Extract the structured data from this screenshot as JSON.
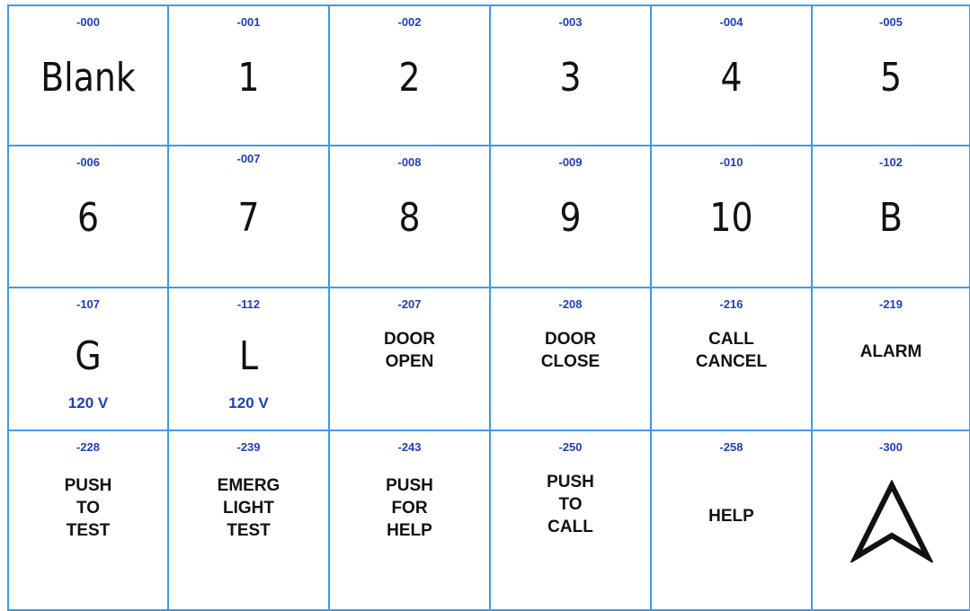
{
  "rows": [
    [
      {
        "code": "-000",
        "label": "Blank"
      },
      {
        "code": "-001",
        "label": "1"
      },
      {
        "code": "-002",
        "label": "2"
      },
      {
        "code": "-003",
        "label": "3"
      },
      {
        "code": "-004",
        "label": "4"
      },
      {
        "code": "-005",
        "label": "5"
      }
    ],
    [
      {
        "code": "-006",
        "label": "6"
      },
      {
        "code": "-007",
        "label": "7"
      },
      {
        "code": "-008",
        "label": "8"
      },
      {
        "code": "-009",
        "label": "9"
      },
      {
        "code": "-010",
        "label": "10"
      },
      {
        "code": "-102",
        "label": "B"
      }
    ],
    [
      {
        "code": "-107",
        "label": "G",
        "voltage": "120 V"
      },
      {
        "code": "-112",
        "label": "L",
        "voltage": "120 V"
      },
      {
        "code": "-207",
        "lines": [
          "DOOR",
          "OPEN"
        ]
      },
      {
        "code": "-208",
        "lines": [
          "DOOR",
          "CLOSE"
        ]
      },
      {
        "code": "-216",
        "lines": [
          "CALL",
          "CANCEL"
        ]
      },
      {
        "code": "-219",
        "lines": [
          "ALARM"
        ]
      }
    ],
    [
      {
        "code": "-228",
        "lines": [
          "PUSH",
          "TO",
          "TEST"
        ]
      },
      {
        "code": "-239",
        "lines": [
          "EMERG",
          "LIGHT",
          "TEST"
        ]
      },
      {
        "code": "-243",
        "lines": [
          "PUSH",
          "FOR",
          "HELP"
        ]
      },
      {
        "code": "-250",
        "lines": [
          "PUSH",
          "TO",
          "CALL"
        ]
      },
      {
        "code": "-258",
        "lines": [
          "HELP"
        ]
      },
      {
        "code": "-300",
        "icon": "up-arrow-outline-icon"
      }
    ]
  ],
  "colors": {
    "grid_border": "#3d9be6",
    "code_text": "#1f3fbf",
    "label_text": "#111111"
  }
}
